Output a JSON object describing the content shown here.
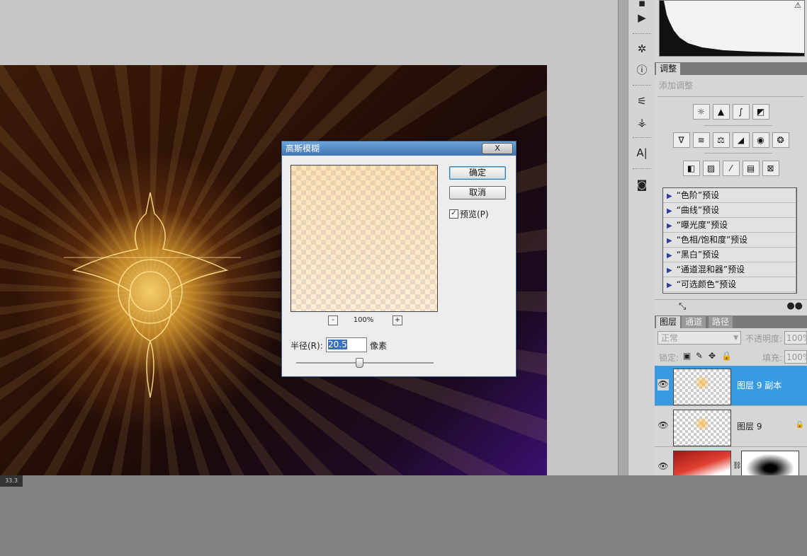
{
  "dialog": {
    "title": "高斯模糊",
    "ok_label": "确定",
    "cancel_label": "取消",
    "preview_label": "预览(P)",
    "preview_checked": true,
    "zoom_minus": "-",
    "zoom_plus": "+",
    "zoom_value": "100%",
    "radius_label": "半径(R):",
    "radius_value": "20.5",
    "radius_unit": "像素",
    "close_label": "X"
  },
  "canvas": {
    "zoom_readout": "33.3"
  },
  "adjustments_panel": {
    "tab_label": "调整",
    "hint": "添加调整",
    "presets": [
      "“色阶”预设",
      "“曲线”预设",
      "“曝光度”预设",
      "“色相/饱和度”预设",
      "“黑白”预设",
      "“通道混和器”预设",
      "“可选颜色”预设"
    ]
  },
  "layers_panel": {
    "tabs": [
      "图层",
      "通道",
      "路径"
    ],
    "blend_mode": "正常",
    "opacity_label": "不透明度:",
    "opacity_value": "100%",
    "lock_label": "锁定:",
    "fill_label": "填充:",
    "fill_value": "100%",
    "layers": [
      {
        "name": "图层 9 副本",
        "selected": true
      },
      {
        "name": "图层 9",
        "selected": false
      }
    ]
  },
  "colors": {
    "selection": "#3a9ae0",
    "title_bar": "#3f74b6",
    "workspace": "#c6c6c6"
  }
}
